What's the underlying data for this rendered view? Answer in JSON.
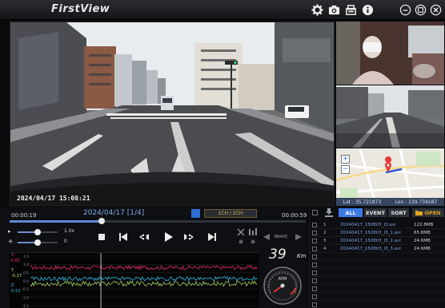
{
  "app": {
    "title": "FirstView"
  },
  "titlebar": {
    "icons": [
      "gear-icon",
      "camera-icon",
      "export-icon",
      "info-icon",
      "minimize-icon",
      "restore-icon",
      "close-icon"
    ]
  },
  "video": {
    "timestamp": "2024/04/17  15:08:21"
  },
  "map": {
    "lat_label": "Lat : 35.721873",
    "lon_label": "Lon : 139.734587",
    "zoom_in": "+",
    "zoom_out": "−"
  },
  "playback": {
    "time_start": "00:00:19",
    "date_label": "2024/04/17   [1/4]",
    "time_end": "00:00:59",
    "channel_label": "1CH / 2CH",
    "progress": 0.31,
    "speed_value": "1.0x",
    "speed_level": 0.5,
    "brightness_value": "0",
    "brightness_level": 0.5
  },
  "gsensor": {
    "x_label": "X",
    "x_value": "0.81",
    "y_label": "Y",
    "y_value": "-0.17",
    "z_label": "Z",
    "z_value": "0.13",
    "ticks": [
      "1.5",
      "1.0",
      "0.5",
      "0.0",
      "-0.5",
      "-1.0",
      "-1.5"
    ],
    "colors": {
      "x": "#ff2e6e",
      "y": "#b7f06a",
      "z": "#33d2ff"
    }
  },
  "dashboard": {
    "brake_label": "BRAKE",
    "speed": "39",
    "speed_unit": "Km",
    "rpm_label": "RPM"
  },
  "files": {
    "tabs": {
      "all": "ALL",
      "event": "EVENT",
      "sort": "SORT",
      "open": "OPEN"
    },
    "rows": [
      {
        "num": "1",
        "name": "20240417_150803_I3.avi",
        "size": "122.8MB"
      },
      {
        "num": "2",
        "name": "20240417_150803_I3_1.avi",
        "size": "65.8MB"
      },
      {
        "num": "3",
        "name": "20240417_150803_I3_2.avi",
        "size": "24.6MB"
      },
      {
        "num": "4",
        "name": "20240417_150803_I3_3.avi",
        "size": "24.6MB"
      }
    ],
    "empty_rows": 7
  },
  "colors": {
    "accent": "#2d6fd6",
    "date_text": "#7fa5e8",
    "tab_active": "#3d7ae6",
    "open_button": "#e0a51d"
  }
}
